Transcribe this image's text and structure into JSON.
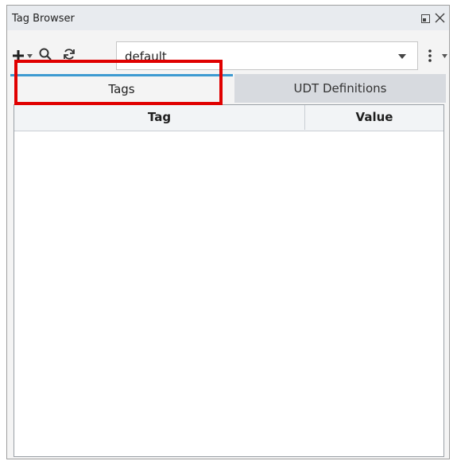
{
  "window": {
    "title": "Tag Browser"
  },
  "toolbar": {
    "provider_value": "default"
  },
  "tabs": [
    {
      "label": "Tags",
      "active": true
    },
    {
      "label": "UDT Definitions",
      "active": false
    }
  ],
  "table": {
    "columns": [
      "Tag",
      "Value"
    ],
    "rows": []
  },
  "icons": {
    "restore": "restore-window-icon",
    "close": "close-icon",
    "add": "plus-icon",
    "search": "search-icon",
    "refresh": "refresh-icon",
    "more": "vertical-ellipsis-icon"
  },
  "colors": {
    "active_tab_indicator": "#3d9ad1",
    "highlight": "#e00000"
  }
}
